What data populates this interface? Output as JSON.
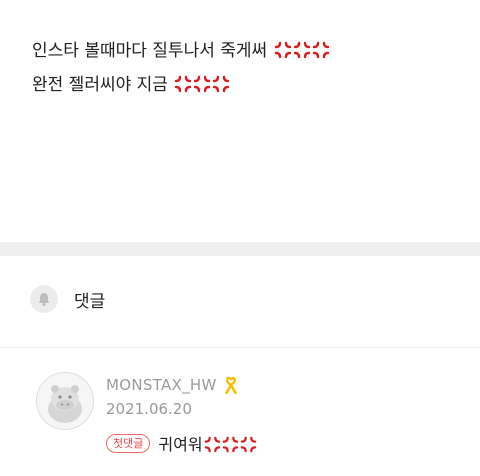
{
  "post": {
    "line1": "인스타 볼때마다 질투나서 죽게써",
    "line2": "완전 젤러씨야 지금",
    "emoji_icon": "anger-symbol-icon",
    "emoji_color": "#d81e1e"
  },
  "comments_section": {
    "label": "댓글",
    "icon": "bell-icon"
  },
  "comment": {
    "author": "MONSTAX_HW",
    "author_badge_icon": "yellow-ribbon-icon",
    "date": "2021.06.20",
    "badge": "첫댓글",
    "text": "귀여워",
    "avatar_icon": "hippo-avatar-icon"
  },
  "colors": {
    "divider": "#efefef",
    "badge": "#e84545",
    "meta_text": "#9a9a9a"
  }
}
